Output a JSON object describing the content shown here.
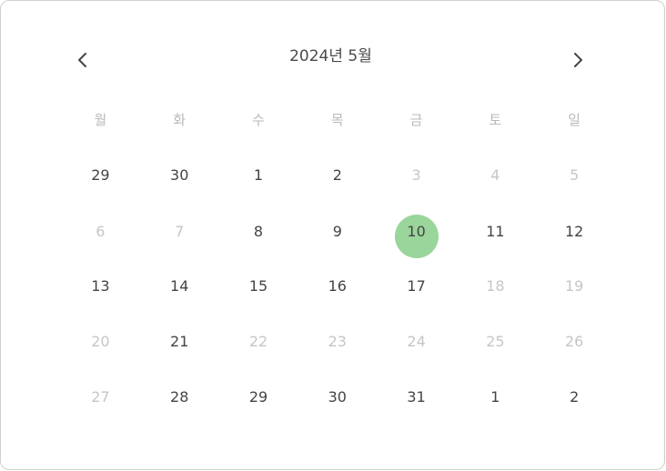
{
  "header": {
    "title": "2024년 5월",
    "prev_icon": "chevron-left-icon",
    "next_icon": "chevron-right-icon"
  },
  "weekdays": [
    "월",
    "화",
    "수",
    "목",
    "금",
    "토",
    "일"
  ],
  "weeks": [
    [
      {
        "label": "29",
        "disabled": false
      },
      {
        "label": "30",
        "disabled": false
      },
      {
        "label": "1",
        "disabled": false
      },
      {
        "label": "2",
        "disabled": false
      },
      {
        "label": "3",
        "disabled": true
      },
      {
        "label": "4",
        "disabled": true
      },
      {
        "label": "5",
        "disabled": true
      }
    ],
    [
      {
        "label": "6",
        "disabled": true
      },
      {
        "label": "7",
        "disabled": true
      },
      {
        "label": "8",
        "disabled": false
      },
      {
        "label": "9",
        "disabled": false
      },
      {
        "label": "10",
        "disabled": false,
        "selected": true
      },
      {
        "label": "11",
        "disabled": false
      },
      {
        "label": "12",
        "disabled": false
      }
    ],
    [
      {
        "label": "13",
        "disabled": false
      },
      {
        "label": "14",
        "disabled": false
      },
      {
        "label": "15",
        "disabled": false
      },
      {
        "label": "16",
        "disabled": false
      },
      {
        "label": "17",
        "disabled": false
      },
      {
        "label": "18",
        "disabled": true
      },
      {
        "label": "19",
        "disabled": true
      }
    ],
    [
      {
        "label": "20",
        "disabled": true
      },
      {
        "label": "21",
        "disabled": false
      },
      {
        "label": "22",
        "disabled": true
      },
      {
        "label": "23",
        "disabled": true
      },
      {
        "label": "24",
        "disabled": true
      },
      {
        "label": "25",
        "disabled": true
      },
      {
        "label": "26",
        "disabled": true
      }
    ],
    [
      {
        "label": "27",
        "disabled": true
      },
      {
        "label": "28",
        "disabled": false
      },
      {
        "label": "29",
        "disabled": false
      },
      {
        "label": "30",
        "disabled": false
      },
      {
        "label": "31",
        "disabled": false
      },
      {
        "label": "1",
        "disabled": false
      },
      {
        "label": "2",
        "disabled": false
      }
    ]
  ],
  "colors": {
    "selected_bg": "#9ad59c",
    "text": "#444444",
    "disabled_text": "#c6c6c6",
    "weekday_text": "#b9b9b9"
  }
}
